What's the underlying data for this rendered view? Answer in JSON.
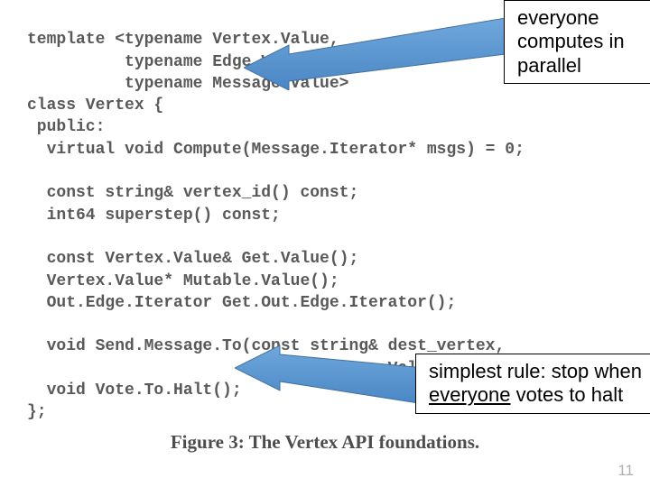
{
  "code": {
    "l1": "template <typename Vertex.Value,",
    "l2": "          typename Edge.Value,",
    "l3": "          typename Message.Value>",
    "l4": "class Vertex {",
    "l5": " public:",
    "l6": "  virtual void Compute(Message.Iterator* msgs) = 0;",
    "l7": "",
    "l8": "  const string& vertex_id() const;",
    "l9": "  int64 superstep() const;",
    "l10": "",
    "l11": "  const Vertex.Value& Get.Value();",
    "l12": "  Vertex.Value* Mutable.Value();",
    "l13": "  Out.Edge.Iterator Get.Out.Edge.Iterator();",
    "l14": "",
    "l15": "  void Send.Message.To(const string& dest_vertex,",
    "l16": "                       const Message.Value& message);",
    "l17": "  void Vote.To.Halt();",
    "l18": "};"
  },
  "callouts": {
    "top": "everyone computes in parallel",
    "bottom_prefix": "simplest rule: stop when ",
    "bottom_em": "everyone",
    "bottom_suffix": " votes to halt"
  },
  "caption": "Figure 3: The Vertex API foundations.",
  "page_number": "11",
  "arrow_color": "#5b9bd5",
  "arrow_stroke": "#41719c"
}
